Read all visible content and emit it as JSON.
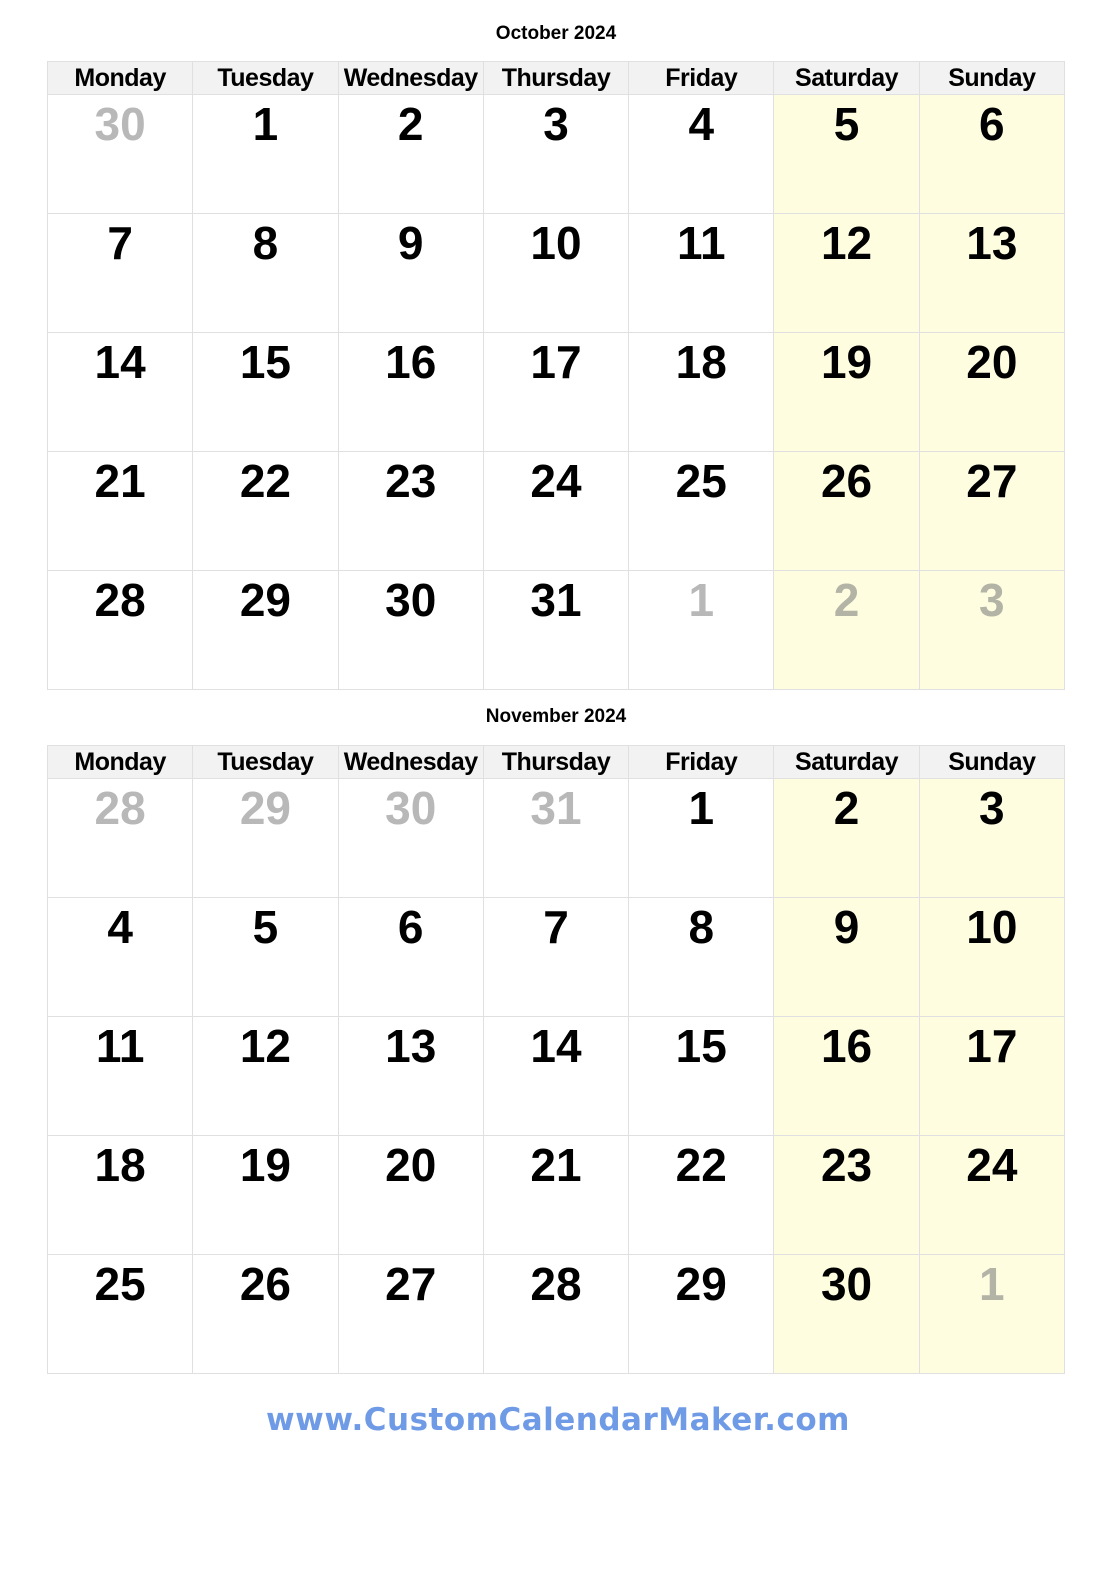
{
  "weekdays": [
    "Monday",
    "Tuesday",
    "Wednesday",
    "Thursday",
    "Friday",
    "Saturday",
    "Sunday"
  ],
  "colors": {
    "weekend_bg": "#fefde0",
    "header_bg": "#f2f2f2",
    "other_month_text": "#b8b8b8",
    "footer_text": "#6f9ae6"
  },
  "months": [
    {
      "title": "October 2024",
      "weeks": [
        [
          {
            "d": "30",
            "other": true
          },
          {
            "d": "1"
          },
          {
            "d": "2"
          },
          {
            "d": "3"
          },
          {
            "d": "4"
          },
          {
            "d": "5"
          },
          {
            "d": "6"
          }
        ],
        [
          {
            "d": "7"
          },
          {
            "d": "8"
          },
          {
            "d": "9"
          },
          {
            "d": "10"
          },
          {
            "d": "11"
          },
          {
            "d": "12"
          },
          {
            "d": "13"
          }
        ],
        [
          {
            "d": "14"
          },
          {
            "d": "15"
          },
          {
            "d": "16"
          },
          {
            "d": "17"
          },
          {
            "d": "18"
          },
          {
            "d": "19"
          },
          {
            "d": "20"
          }
        ],
        [
          {
            "d": "21"
          },
          {
            "d": "22"
          },
          {
            "d": "23"
          },
          {
            "d": "24"
          },
          {
            "d": "25"
          },
          {
            "d": "26"
          },
          {
            "d": "27"
          }
        ],
        [
          {
            "d": "28"
          },
          {
            "d": "29"
          },
          {
            "d": "30"
          },
          {
            "d": "31"
          },
          {
            "d": "1",
            "other": true
          },
          {
            "d": "2",
            "other": true
          },
          {
            "d": "3",
            "other": true
          }
        ]
      ]
    },
    {
      "title": "November 2024",
      "weeks": [
        [
          {
            "d": "28",
            "other": true
          },
          {
            "d": "29",
            "other": true
          },
          {
            "d": "30",
            "other": true
          },
          {
            "d": "31",
            "other": true
          },
          {
            "d": "1"
          },
          {
            "d": "2"
          },
          {
            "d": "3"
          }
        ],
        [
          {
            "d": "4"
          },
          {
            "d": "5"
          },
          {
            "d": "6"
          },
          {
            "d": "7"
          },
          {
            "d": "8"
          },
          {
            "d": "9"
          },
          {
            "d": "10"
          }
        ],
        [
          {
            "d": "11"
          },
          {
            "d": "12"
          },
          {
            "d": "13"
          },
          {
            "d": "14"
          },
          {
            "d": "15"
          },
          {
            "d": "16"
          },
          {
            "d": "17"
          }
        ],
        [
          {
            "d": "18"
          },
          {
            "d": "19"
          },
          {
            "d": "20"
          },
          {
            "d": "21"
          },
          {
            "d": "22"
          },
          {
            "d": "23"
          },
          {
            "d": "24"
          }
        ],
        [
          {
            "d": "25"
          },
          {
            "d": "26"
          },
          {
            "d": "27"
          },
          {
            "d": "28"
          },
          {
            "d": "29"
          },
          {
            "d": "30"
          },
          {
            "d": "1",
            "other": true
          }
        ]
      ]
    }
  ],
  "footer": {
    "text": "www.CustomCalendarMaker.com"
  }
}
